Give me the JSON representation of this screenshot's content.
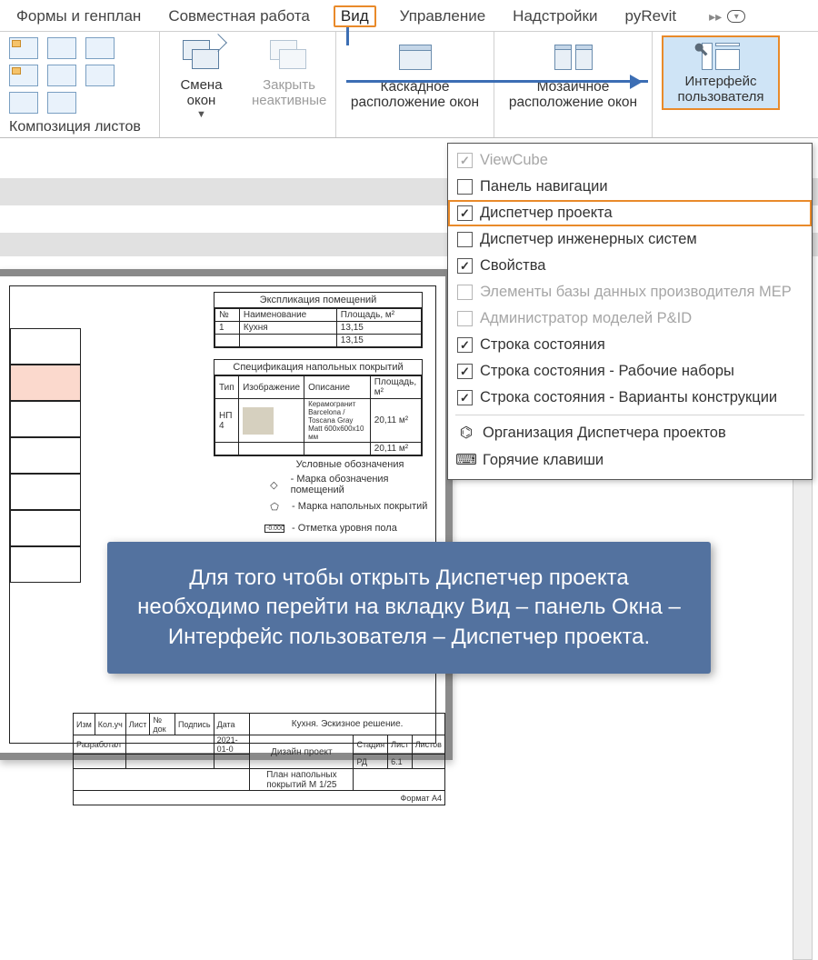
{
  "tabs": {
    "forms": "Формы и генплан",
    "collab": "Совместная работа",
    "view": "Вид",
    "manage": "Управление",
    "addins": "Надстройки",
    "pyrevit": "pyRevit"
  },
  "ribbon": {
    "composition_label": "Композиция листов",
    "switch_windows": "Смена\nокон",
    "close_inactive": "Закрыть\nнеактивные",
    "cascade": "Каскадное\nрасположение окон",
    "tile": "Мозаичное\nрасположение окон",
    "ui_button": "Интерфейс\nпользователя"
  },
  "dropdown": [
    {
      "label": "ViewCube",
      "checked": true,
      "disabled": true
    },
    {
      "label": "Панель навигации",
      "checked": false,
      "disabled": false
    },
    {
      "label": "Диспетчер проекта",
      "checked": true,
      "disabled": false,
      "highlight": true
    },
    {
      "label": "Диспетчер инженерных систем",
      "checked": false,
      "disabled": false
    },
    {
      "label": "Свойства",
      "checked": true,
      "disabled": false
    },
    {
      "label": "Элементы базы данных производителя MEP",
      "checked": false,
      "disabled": true
    },
    {
      "label": "Администратор моделей P&ID",
      "checked": false,
      "disabled": true
    },
    {
      "label": "Строка состояния",
      "checked": true,
      "disabled": false
    },
    {
      "label": "Строка состояния - Рабочие наборы",
      "checked": true,
      "disabled": false
    },
    {
      "label": "Строка состояния - Варианты конструкции",
      "checked": true,
      "disabled": false
    }
  ],
  "dropdown_cmds": {
    "org": "Организация Диспетчера проектов",
    "keys": "Горячие клавиши"
  },
  "sheet": {
    "sched1_title": "Экспликация помещений",
    "sched1_h1": "№",
    "sched1_h2": "Наименование",
    "sched1_h3": "Площадь, м²",
    "sched1_r1_no": "1",
    "sched1_r1_name": "Кухня",
    "sched1_r1_area": "13,15",
    "sched1_total": "13,15",
    "sched2_title": "Спецификация напольных покрытий",
    "sched2_h1": "Тип",
    "sched2_h2": "Изображение",
    "sched2_h3": "Описание",
    "sched2_h4": "Площадь, м²",
    "sched2_r1_type": "НП 4",
    "sched2_r1_desc": "Керамогранит Barcelona / Toscana Gray Matt 600x600x10 мм",
    "sched2_r1_area": "20,11 м²",
    "sched2_total": "20,11 м²",
    "legend_title": "Условные обозначения",
    "legend_1": "- Марка обозначения помещений",
    "legend_2": "- Марка напольных покрытий",
    "legend_3": "- Отметка уровня пола",
    "tb_dr_title": "Кухня. Эскизное решение.",
    "tb_project": "Дизайн проект",
    "tb_sheet": "План напольных покрытий М 1/25",
    "tb_stage_h": "Стадия",
    "tb_sheet_h": "Лист",
    "tb_sheets_h": "Листов",
    "tb_stage": "РД",
    "tb_sheetno": "6.1",
    "tb_format": "Формат  A4"
  },
  "callout": "Для того чтобы открыть Диспетчер проекта необходимо перейти на вкладку Вид – панель Окна – Интерфейс пользователя – Диспетчер проекта."
}
